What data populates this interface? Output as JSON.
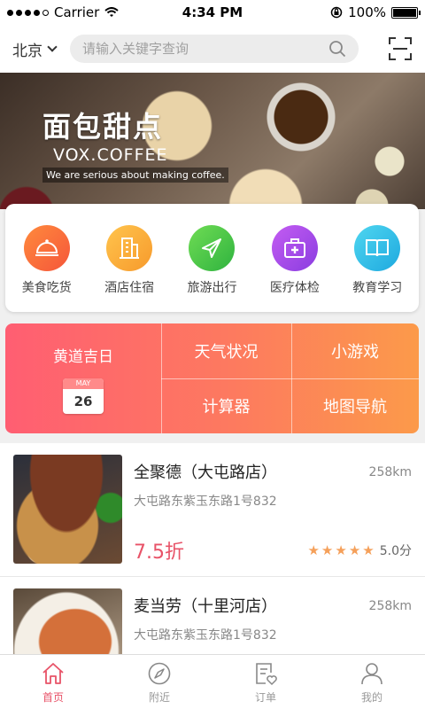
{
  "status_bar": {
    "carrier": "Carrier",
    "time": "4:34 PM",
    "battery": "100%"
  },
  "header": {
    "city": "北京",
    "search_placeholder": "请输入关键字查询"
  },
  "banner": {
    "title": "面包甜点",
    "subtitle": "VOX.COFFEE",
    "tagline": "We are serious about making coffee."
  },
  "categories": [
    {
      "label": "美食吃货",
      "icon": "cloche-icon",
      "colors": [
        "#ff8a3d",
        "#f5563a"
      ]
    },
    {
      "label": "酒店住宿",
      "icon": "building-icon",
      "colors": [
        "#ffc44d",
        "#f79a2c"
      ]
    },
    {
      "label": "旅游出行",
      "icon": "airplane-icon",
      "colors": [
        "#6fdc54",
        "#2fb33f"
      ]
    },
    {
      "label": "医疗体检",
      "icon": "medical-kit-icon",
      "colors": [
        "#c45cf2",
        "#8a3de0"
      ]
    },
    {
      "label": "教育学习",
      "icon": "book-icon",
      "colors": [
        "#4fd6f0",
        "#1ea9df"
      ]
    }
  ],
  "tools": {
    "lucky_day": "黄道吉日",
    "calendar_month": "MAY",
    "calendar_day": "26",
    "weather": "天气状况",
    "games": "小游戏",
    "calculator": "计算器",
    "map": "地图导航"
  },
  "restaurants": [
    {
      "name": "全聚德（大屯路店）",
      "address": "大屯路东紫玉东路1号832",
      "distance": "258km",
      "discount": "7.5折",
      "rating": 5,
      "score": "5.0分"
    },
    {
      "name": "麦当劳（十里河店）",
      "address": "大屯路东紫玉东路1号832",
      "distance": "258km"
    }
  ],
  "tabbar": [
    {
      "label": "首页",
      "icon": "home-icon",
      "active": true
    },
    {
      "label": "附近",
      "icon": "compass-icon",
      "active": false
    },
    {
      "label": "订单",
      "icon": "order-list-icon",
      "active": false
    },
    {
      "label": "我的",
      "icon": "user-icon",
      "active": false
    }
  ],
  "colors": {
    "accent": "#e85368",
    "star": "#f5a05a"
  }
}
